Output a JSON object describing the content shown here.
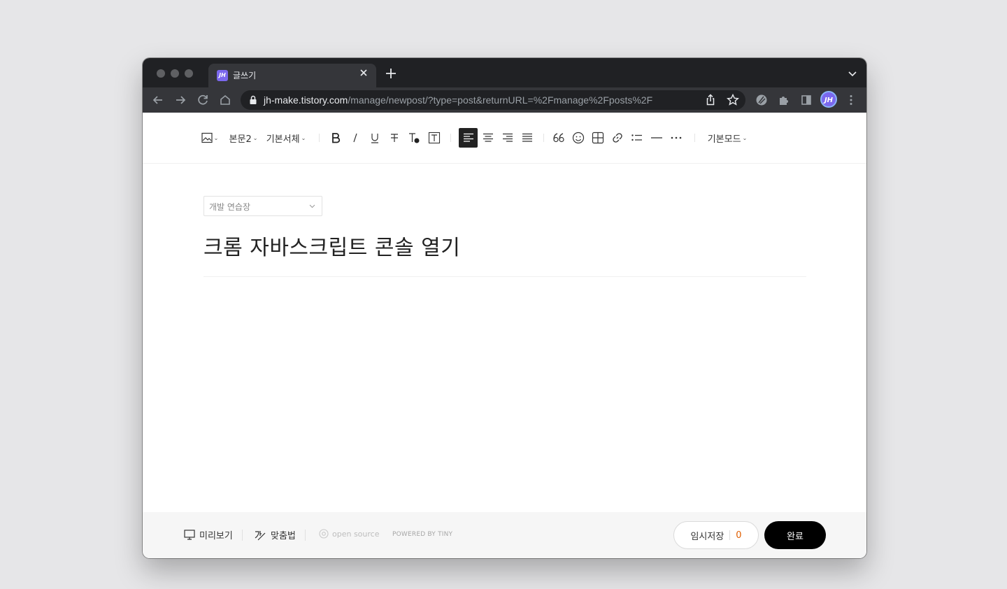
{
  "browser": {
    "tab_title": "글쓰기",
    "favicon_text": "JH",
    "url_host": "jh-make.tistory.com",
    "url_path": "/manage/newpost/?type=post&returnURL=%2Fmanage%2Fposts%2F",
    "profile_initials": "JH",
    "colors": {
      "tabbar": "#202124",
      "toolbar": "#35363a",
      "favicon": "#7b68ee"
    }
  },
  "toolbar": {
    "paragraph_style": "본문2",
    "font_family": "기본서체",
    "mode": "기본모드",
    "icons": [
      "image-icon",
      "bold-icon",
      "italic-icon",
      "underline-icon",
      "strikethrough-icon",
      "text-color-icon",
      "text-background-icon",
      "align-left-icon",
      "align-center-icon",
      "align-right-icon",
      "align-justify-icon",
      "quote-icon",
      "emoji-icon",
      "table-icon",
      "link-icon",
      "list-icon",
      "horizontal-rule-icon",
      "more-icon"
    ],
    "active": "align-left"
  },
  "editor": {
    "category": "개발 연습장",
    "title": "크롬 자바스크립트 콘솔 열기"
  },
  "footer": {
    "preview_label": "미리보기",
    "spellcheck_label": "맞춤법",
    "opensource_label": "open source",
    "powered_label": "POWERED BY TINY",
    "draft_label": "임시저장",
    "draft_count": "0",
    "done_label": "완료",
    "colors": {
      "draft_count": "#e05e00",
      "done_bg": "#000000"
    }
  }
}
